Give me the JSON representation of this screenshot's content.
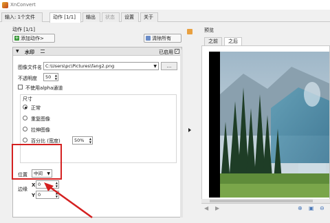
{
  "window": {
    "title": "XnConvert"
  },
  "tabs": [
    {
      "label": "输入: 1个文件",
      "state": "normal"
    },
    {
      "label": "动作 [1/1]",
      "state": "active"
    },
    {
      "label": "输出",
      "state": "normal"
    },
    {
      "label": "状态",
      "state": "disabled"
    },
    {
      "label": "设置",
      "state": "normal"
    },
    {
      "label": "关于",
      "state": "normal"
    }
  ],
  "actions_panel": {
    "section_label": "动作 [1/1]",
    "add_action_label": "添加动作>",
    "clear_all_label": "清除所有",
    "action": {
      "name": "水印",
      "enabled_label": "已启用",
      "enabled": true,
      "image_file_label": "图像文件名",
      "image_file_value": "C:\\Users\\pc\\Pictures\\fang2.png",
      "browse_label": "...",
      "opacity_label": "不透明度",
      "opacity_value": "50",
      "alpha_label": "不使用alpha通道",
      "alpha_checked": false,
      "size_group_label": "尺寸",
      "size_options": [
        {
          "label": "正常",
          "selected": true
        },
        {
          "label": "重复图像",
          "selected": false
        },
        {
          "label": "拉伸图像",
          "selected": false
        },
        {
          "label": "百分比 (宽度)",
          "selected": false
        }
      ],
      "percent_value": "50%",
      "position_label": "位置",
      "position_value": "中间",
      "margin_label": "边缘",
      "x_label": "X",
      "x_value": "0",
      "y_label": "Y",
      "y_value": "0"
    }
  },
  "preview": {
    "label": "预览",
    "tabs": [
      {
        "label": "之前",
        "active": false
      },
      {
        "label": "之后",
        "active": true
      }
    ]
  },
  "colors": {
    "highlight": "#d42020",
    "accent_green": "#3c9a3c"
  }
}
